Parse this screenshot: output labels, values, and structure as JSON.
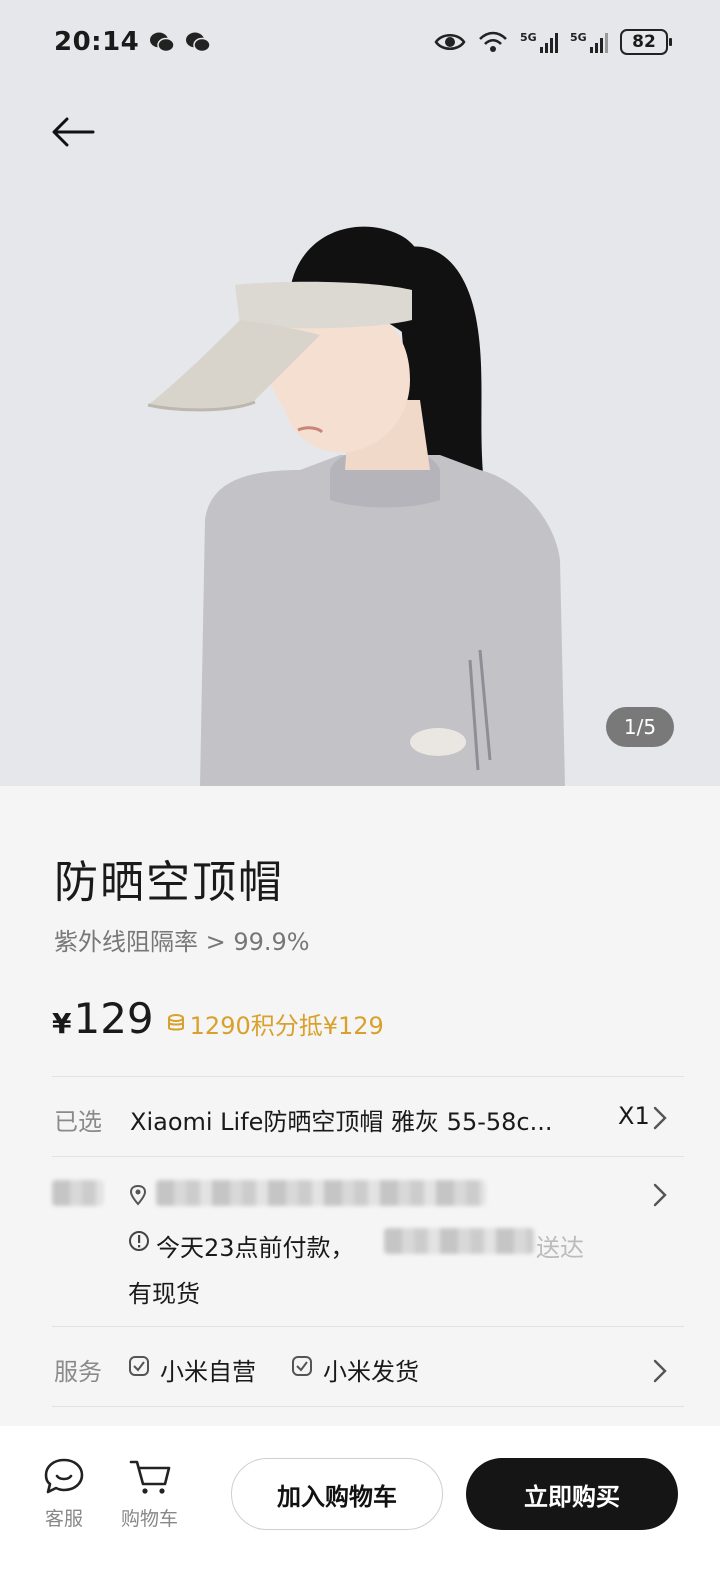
{
  "status_bar": {
    "time": "20:14",
    "battery": "82",
    "network_1": "5G",
    "network_2": "5G"
  },
  "gallery": {
    "indicator": "1/5"
  },
  "product": {
    "title": "防晒空顶帽",
    "subtitle": "紫外线阻隔率 > 99.9%",
    "price_symbol": "¥",
    "price": "129",
    "points_text": "1290积分抵¥129"
  },
  "selected": {
    "label": "已选",
    "value": "Xiaomi Life防晒空顶帽 雅灰 55-58c...",
    "quantity": "X1"
  },
  "delivery": {
    "notice": "今天23点前付款，",
    "notice_tail": "送达",
    "stock": "有现货"
  },
  "service": {
    "label": "服务",
    "tags": [
      "小米自营",
      "小米发货"
    ]
  },
  "bottom_bar": {
    "service_label": "客服",
    "cart_label": "购物车",
    "add_to_cart": "加入购物车",
    "buy_now": "立即购买"
  },
  "colors": {
    "accent_gold": "#d9a12b",
    "dark_button": "#151515"
  }
}
